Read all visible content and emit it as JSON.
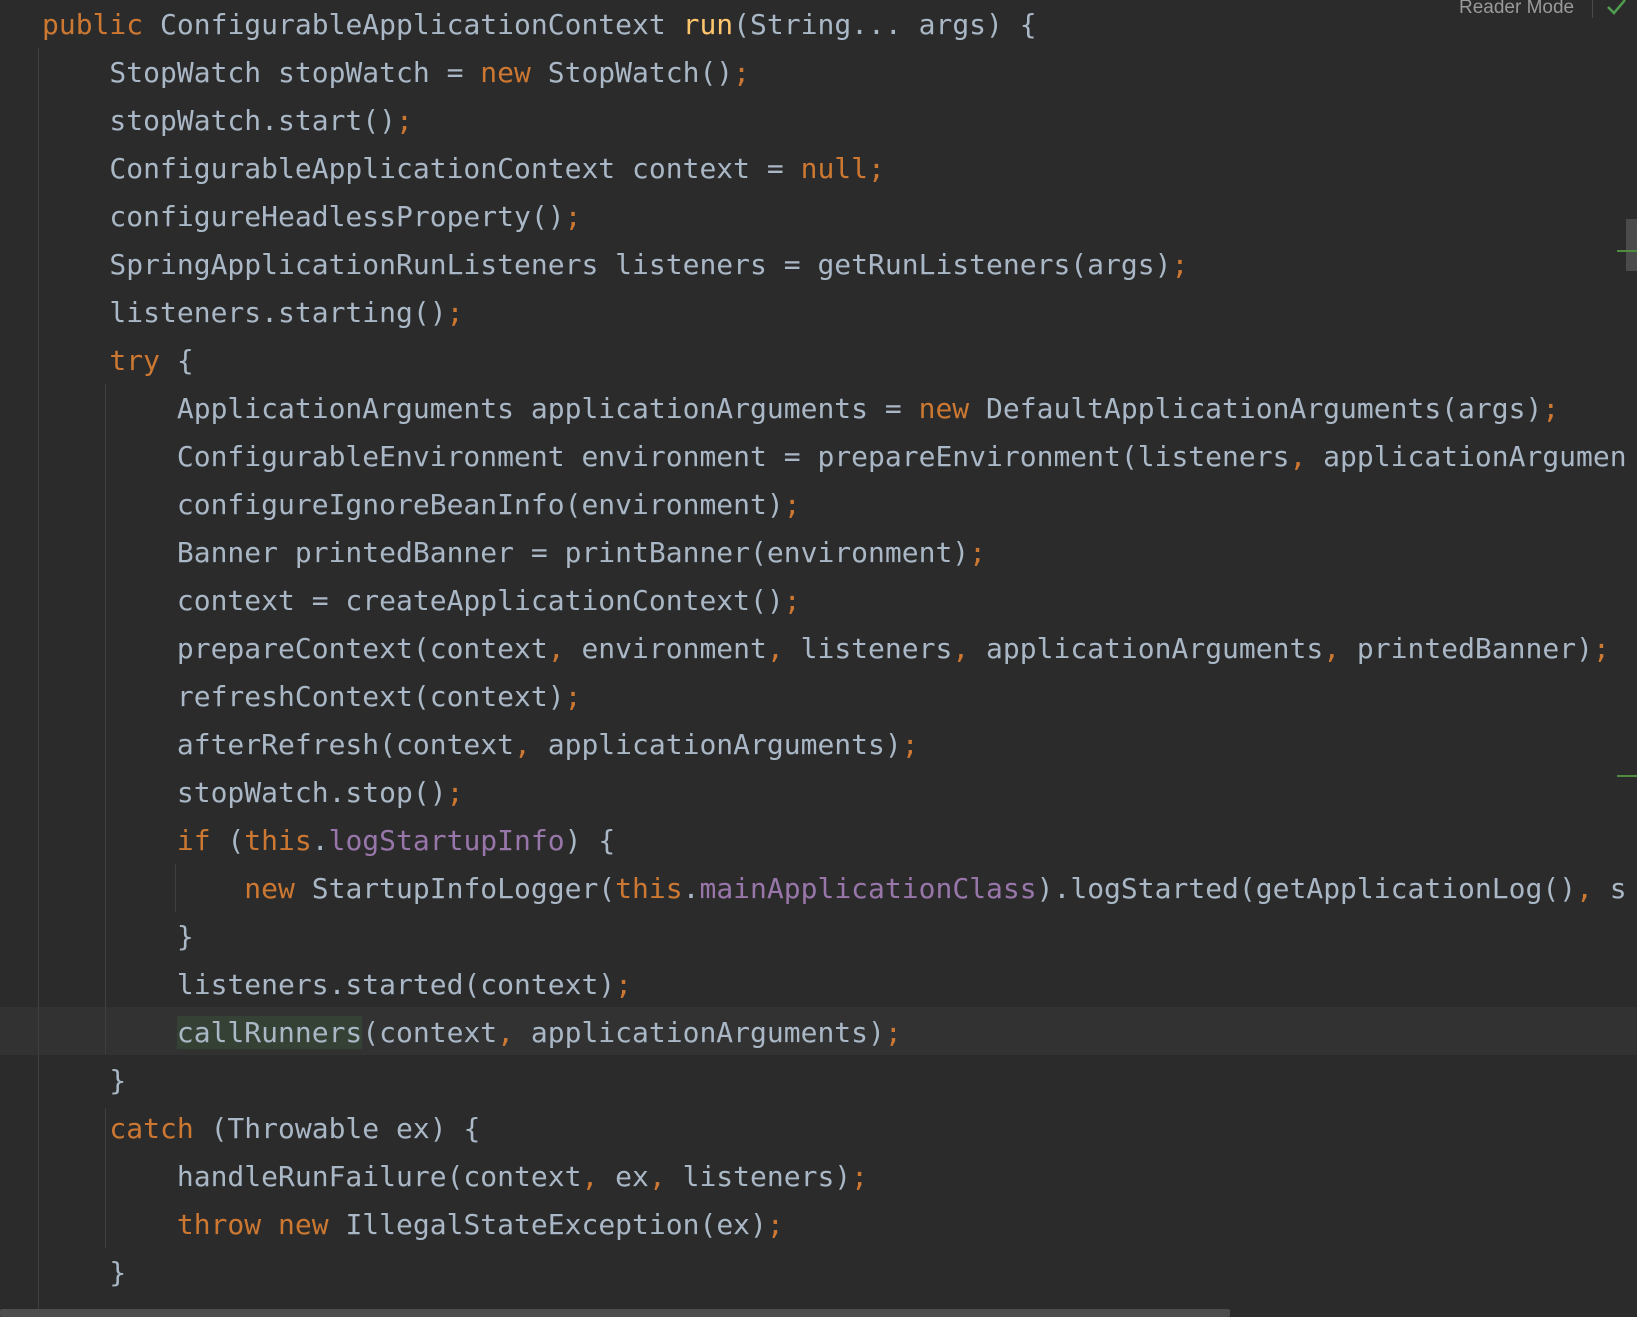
{
  "toolbar": {
    "reader_mode_label": "Reader Mode",
    "status_icon": "green-check-icon"
  },
  "colors": {
    "background": "#2b2b2b",
    "keyword": "#cc7832",
    "identifier": "#a9b7c6",
    "method_declaration": "#ffc66d",
    "field": "#9876aa",
    "caret_row": "#323232",
    "usage_highlight": "#344134",
    "change_marker": "#4f8c3e"
  },
  "code": {
    "language": "java",
    "lines": [
      [
        [
          "kw",
          "public"
        ],
        [
          "id",
          " ConfigurableApplicationContext "
        ],
        [
          "fn",
          "run"
        ],
        [
          "id",
          "(String... args) {"
        ]
      ],
      [
        [
          "id",
          "    StopWatch stopWatch = "
        ],
        [
          "kw",
          "new"
        ],
        [
          "id",
          " StopWatch()"
        ],
        [
          "semi",
          ";"
        ]
      ],
      [
        [
          "id",
          "    stopWatch.start()"
        ],
        [
          "semi",
          ";"
        ]
      ],
      [
        [
          "id",
          "    ConfigurableApplicationContext context = "
        ],
        [
          "kw",
          "null"
        ],
        [
          "semi",
          ";"
        ]
      ],
      [
        [
          "id",
          "    configureHeadlessProperty()"
        ],
        [
          "semi",
          ";"
        ]
      ],
      [
        [
          "id",
          "    SpringApplicationRunListeners listeners = getRunListeners(args)"
        ],
        [
          "semi",
          ";"
        ]
      ],
      [
        [
          "id",
          "    listeners.starting()"
        ],
        [
          "semi",
          ";"
        ]
      ],
      [
        [
          "kw",
          "    try"
        ],
        [
          "id",
          " {"
        ]
      ],
      [
        [
          "id",
          "        ApplicationArguments applicationArguments = "
        ],
        [
          "kw",
          "new"
        ],
        [
          "id",
          " DefaultApplicationArguments(args)"
        ],
        [
          "semi",
          ";"
        ]
      ],
      [
        [
          "id",
          "        ConfigurableEnvironment environment = prepareEnvironment(listeners"
        ],
        [
          "comma",
          ","
        ],
        [
          "id",
          " applicationArgumen"
        ]
      ],
      [
        [
          "id",
          "        configureIgnoreBeanInfo(environment)"
        ],
        [
          "semi",
          ";"
        ]
      ],
      [
        [
          "id",
          "        Banner printedBanner = printBanner(environment)"
        ],
        [
          "semi",
          ";"
        ]
      ],
      [
        [
          "id",
          "        context = createApplicationContext()"
        ],
        [
          "semi",
          ";"
        ]
      ],
      [
        [
          "id",
          "        prepareContext(context"
        ],
        [
          "comma",
          ","
        ],
        [
          "id",
          " environment"
        ],
        [
          "comma",
          ","
        ],
        [
          "id",
          " listeners"
        ],
        [
          "comma",
          ","
        ],
        [
          "id",
          " applicationArguments"
        ],
        [
          "comma",
          ","
        ],
        [
          "id",
          " printedBanner)"
        ],
        [
          "semi",
          ";"
        ]
      ],
      [
        [
          "id",
          "        refreshContext(context)"
        ],
        [
          "semi",
          ";"
        ]
      ],
      [
        [
          "id",
          "        afterRefresh(context"
        ],
        [
          "comma",
          ","
        ],
        [
          "id",
          " applicationArguments)"
        ],
        [
          "semi",
          ";"
        ]
      ],
      [
        [
          "id",
          "        stopWatch.stop()"
        ],
        [
          "semi",
          ";"
        ]
      ],
      [
        [
          "kw",
          "        if"
        ],
        [
          "id",
          " ("
        ],
        [
          "kw",
          "this"
        ],
        [
          "id",
          "."
        ],
        [
          "fld",
          "logStartupInfo"
        ],
        [
          "id",
          ") {"
        ]
      ],
      [
        [
          "kw",
          "            new"
        ],
        [
          "id",
          " StartupInfoLogger("
        ],
        [
          "kw",
          "this"
        ],
        [
          "id",
          "."
        ],
        [
          "fld",
          "mainApplicationClass"
        ],
        [
          "id",
          ").logStarted(getApplicationLog()"
        ],
        [
          "comma",
          ","
        ],
        [
          "id",
          " s"
        ]
      ],
      [
        [
          "id",
          "        }"
        ]
      ],
      [
        [
          "id",
          "        listeners.started(context)"
        ],
        [
          "semi",
          ";"
        ]
      ],
      [
        [
          "id",
          "        "
        ],
        [
          "ref",
          "callRunners"
        ],
        [
          "id",
          "(context"
        ],
        [
          "comma",
          ","
        ],
        [
          "id",
          " applicationArguments)"
        ],
        [
          "semi",
          ";"
        ]
      ],
      [
        [
          "id",
          "    }"
        ]
      ],
      [
        [
          "kw",
          "    catch"
        ],
        [
          "id",
          " (Throwable ex) {"
        ]
      ],
      [
        [
          "id",
          "        handleRunFailure(context"
        ],
        [
          "comma",
          ","
        ],
        [
          "id",
          " ex"
        ],
        [
          "comma",
          ","
        ],
        [
          "id",
          " listeners)"
        ],
        [
          "semi",
          ";"
        ]
      ],
      [
        [
          "kw",
          "        throw"
        ],
        [
          "id",
          " "
        ],
        [
          "kw",
          "new"
        ],
        [
          "id",
          " IllegalStateException(ex)"
        ],
        [
          "semi",
          ";"
        ]
      ],
      [
        [
          "id",
          "    }"
        ]
      ]
    ]
  }
}
